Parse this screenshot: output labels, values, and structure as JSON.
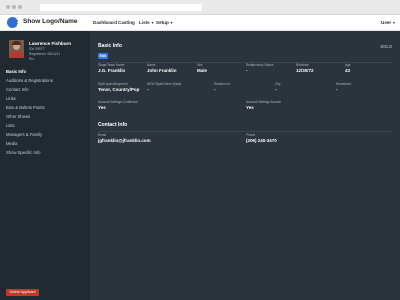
{
  "colors": {
    "accent": "#2f7ae5",
    "sidebar_bg": "#222a31",
    "panel_bg": "#2b343c",
    "danger": "#c0392b"
  },
  "app": {
    "title": "Show Logo/Name"
  },
  "nav": {
    "items": [
      {
        "label": "Dashboard",
        "dropdown": false
      },
      {
        "label": "Casting",
        "dropdown": false
      },
      {
        "label": "Lists",
        "dropdown": true
      },
      {
        "label": "Setup",
        "dropdown": true
      }
    ],
    "user_label": "User"
  },
  "profile": {
    "name": "Lawrence Fishburn",
    "line1": "ID# 39977",
    "line2": "Registered: 08/14/11",
    "line3": "Ro..."
  },
  "sidebar": {
    "items": [
      {
        "label": "Basic Info",
        "active": true
      },
      {
        "label": "Auditions & Registrations",
        "active": false
      },
      {
        "label": "Contact Info",
        "active": false
      },
      {
        "label": "Links",
        "active": false
      },
      {
        "label": "Bios & Bullets Points",
        "active": false
      },
      {
        "label": "Other Shows",
        "active": false
      },
      {
        "label": "Lists",
        "active": false
      },
      {
        "label": "Managers & Family",
        "active": false
      },
      {
        "label": "Media",
        "active": false
      },
      {
        "label": "Show Specific Info",
        "active": false
      }
    ],
    "delete_label": "Delete Applicant"
  },
  "basic_info": {
    "title": "Basic Info",
    "badge": "SOLO",
    "edit_label": "Edit",
    "fields": [
      {
        "label": "Stage/Team Name",
        "value": "J.G. Franklin"
      },
      {
        "label": "Name",
        "value": "John Franklin"
      },
      {
        "label": "Sex",
        "value": "Male"
      },
      {
        "label": "Relationship Status",
        "value": "-"
      },
      {
        "label": "Birthdate",
        "value": "12/30/72"
      },
      {
        "label": "Age",
        "value": "43"
      },
      {
        "label": "Style (specific/genre)",
        "value": "Tenor, Country/Pop"
      },
      {
        "label": "NEW Style/Genre (beta)",
        "value": "-"
      },
      {
        "label": "Resident of",
        "value": "-"
      },
      {
        "label": "City",
        "value": "-"
      },
      {
        "label": "Hometown",
        "value": "-"
      },
      {
        "label": "Account Settings Confirmed",
        "value": "Yes"
      },
      {
        "label": "Account Settings Access",
        "value": "Yes"
      }
    ]
  },
  "contact_info": {
    "title": "Contact Info",
    "fields": [
      {
        "label": "Email",
        "value": "jgfranklin@jfranklin.com"
      },
      {
        "label": "Phone",
        "value": "(206) 240-3470"
      }
    ]
  }
}
